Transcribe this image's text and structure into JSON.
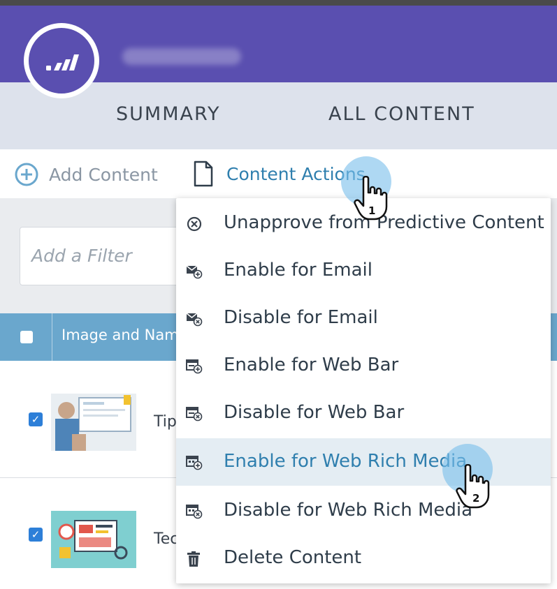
{
  "tabs": {
    "summary": "SUMMARY",
    "all_content": "ALL CONTENT"
  },
  "toolbar": {
    "add_content": "Add Content",
    "content_actions": "Content Actions"
  },
  "filter": {
    "placeholder": "Add a Filter"
  },
  "table": {
    "header_image_and_name": "Image and Nam",
    "rows": [
      {
        "name": "Tip",
        "checked": true
      },
      {
        "name": "Tec",
        "checked": true
      }
    ]
  },
  "menu": {
    "items": [
      {
        "label": "Unapprove from Predictive Content",
        "icon": "circle-x-icon"
      },
      {
        "label": "Enable for Email",
        "icon": "email-add-icon"
      },
      {
        "label": "Disable for Email",
        "icon": "email-remove-icon"
      },
      {
        "label": "Enable for Web Bar",
        "icon": "webbar-add-icon"
      },
      {
        "label": "Disable for Web Bar",
        "icon": "webbar-remove-icon"
      },
      {
        "label": "Enable for Web Rich Media",
        "icon": "richmedia-add-icon",
        "highlighted": true
      },
      {
        "label": "Disable for Web Rich Media",
        "icon": "richmedia-remove-icon"
      },
      {
        "label": "Delete Content",
        "icon": "trash-icon"
      }
    ]
  },
  "callouts": {
    "step1": "1",
    "step2": "2"
  },
  "colors": {
    "header": "#5a4fb0",
    "tabs_bg": "#dde2ec",
    "table_header": "#6aa7cd",
    "accent_text": "#2f7fae",
    "highlight_row": "#e4edf3",
    "checkbox": "#2d7fd8"
  }
}
